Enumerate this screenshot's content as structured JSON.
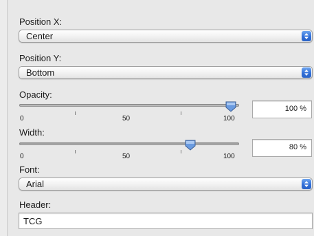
{
  "position_x": {
    "label": "Position X:",
    "value": "Center"
  },
  "position_y": {
    "label": "Position Y:",
    "value": "Bottom"
  },
  "opacity": {
    "label": "Opacity:",
    "value": 100,
    "display": "100 %",
    "min_label": "0",
    "mid_label": "50",
    "max_label": "100"
  },
  "width": {
    "label": "Width:",
    "value": 80,
    "display": "80 %",
    "min_label": "0",
    "mid_label": "50",
    "max_label": "100"
  },
  "font": {
    "label": "Font:",
    "value": "Arial"
  },
  "header": {
    "label": "Header:",
    "value": "TCG"
  },
  "colors": {
    "accent": "#2f6ed8",
    "thumb": "#6a9be0"
  }
}
